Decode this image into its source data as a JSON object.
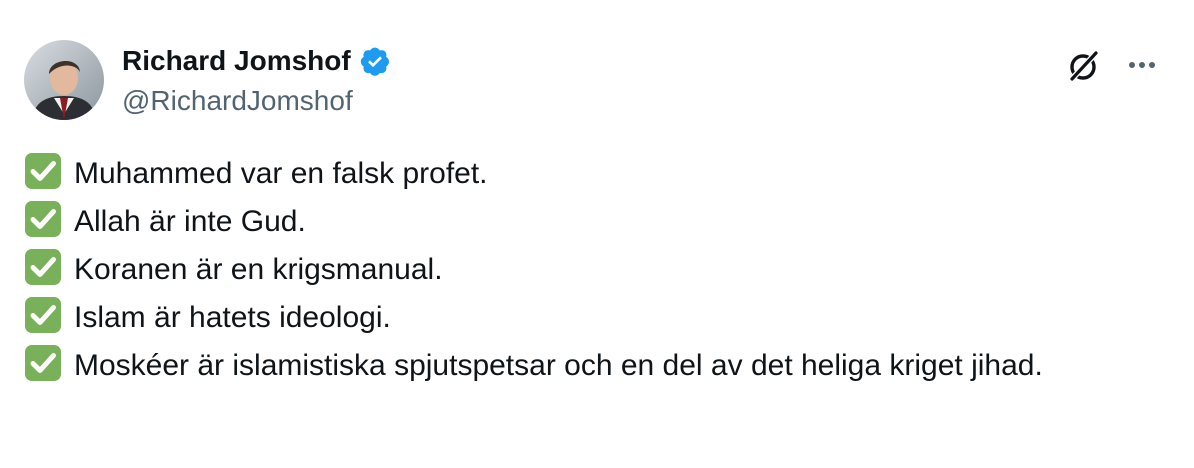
{
  "tweet": {
    "author": {
      "display_name": "Richard Jomshof",
      "handle": "@RichardJomshof",
      "verified": true,
      "verified_color": "#1d9bf0"
    },
    "icons": {
      "grok": "grok-icon",
      "more": "more-options-icon",
      "check": "white-check-mark-on-green-icon"
    },
    "check_color": "#78b159",
    "lines": [
      "Muhammed var en falsk profet.",
      "Allah är inte Gud.",
      "Koranen är en krigsmanual.",
      "Islam är hatets ideologi.",
      "Moskéer är islamistiska spjutspetsar och en del av det heliga kriget jihad."
    ]
  }
}
